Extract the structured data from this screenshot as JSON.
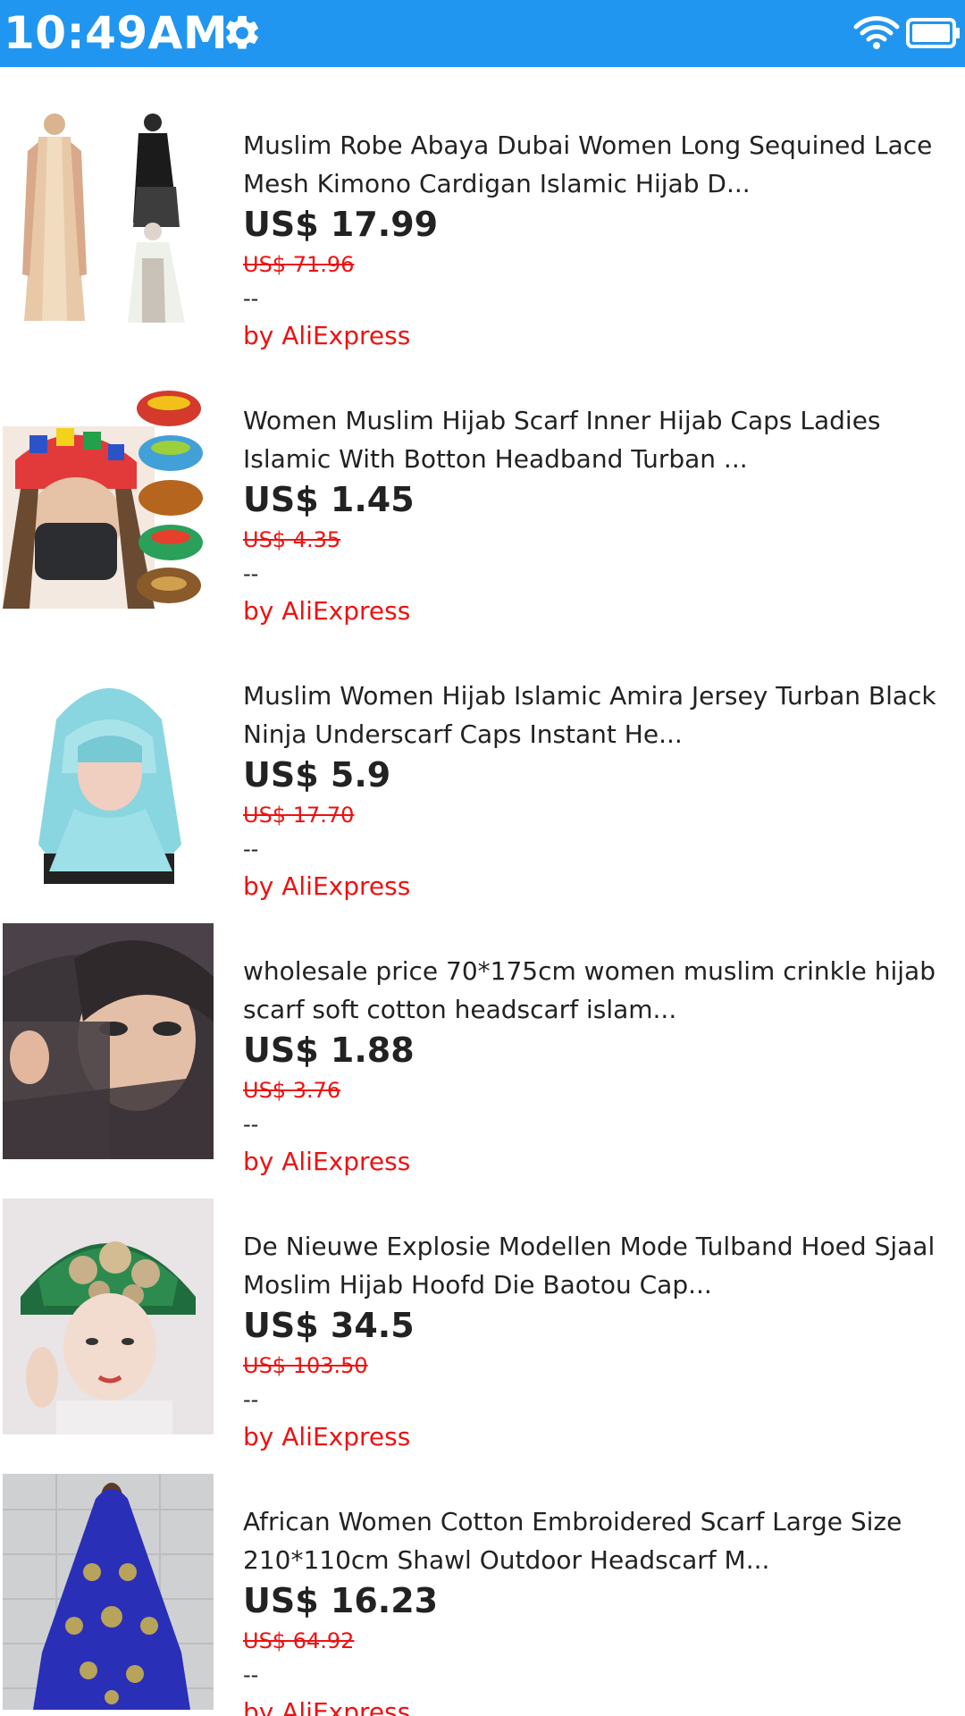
{
  "status_bar": {
    "time": "10:49AM",
    "icons": [
      "gear-icon",
      "wifi-icon",
      "battery-icon"
    ],
    "background": "#2196f0"
  },
  "products": [
    {
      "title_line1": "Muslim Robe Abaya Dubai Women Long Sequined Lace",
      "title_line2": "Mesh Kimono Cardigan Islamic Hijab D...",
      "price": "US$ 17.99",
      "old_price": "US$ 71.96",
      "rating": "--",
      "seller": "by AliExpress"
    },
    {
      "title_line1": "Women Muslim Hijab Scarf Inner Hijab Caps Ladies",
      "title_line2": "Islamic With Botton Headband Turban ...",
      "price": "US$ 1.45",
      "old_price": "US$ 4.35",
      "rating": "--",
      "seller": "by AliExpress"
    },
    {
      "title_line1": "Muslim Women Hijab Islamic Amira Jersey Turban Black",
      "title_line2": "Ninja Underscarf Caps Instant He...",
      "price": "US$ 5.9",
      "old_price": "US$ 17.70",
      "rating": "--",
      "seller": "by AliExpress"
    },
    {
      "title_line1": "wholesale price 70*175cm women muslim crinkle hijab",
      "title_line2": "scarf soft cotton headscarf islam...",
      "price": "US$ 1.88",
      "old_price": "US$ 3.76",
      "rating": "--",
      "seller": "by AliExpress"
    },
    {
      "title_line1": "De Nieuwe Explosie Modellen Mode Tulband Hoed Sjaal",
      "title_line2": "Moslim Hijab Hoofd Die Baotou Cap...",
      "price": "US$ 34.5",
      "old_price": "US$ 103.50",
      "rating": "--",
      "seller": "by AliExpress"
    },
    {
      "title_line1": "African Women Cotton Embroidered Scarf Large Size",
      "title_line2": "210*110cm Shawl Outdoor Headscarf M...",
      "price": "US$ 16.23",
      "old_price": "US$ 64.92",
      "rating": "--",
      "seller": "by AliExpress"
    }
  ],
  "colors": {
    "price_text": "#222222",
    "old_price": "#ee1111",
    "seller": "#ee1111"
  }
}
